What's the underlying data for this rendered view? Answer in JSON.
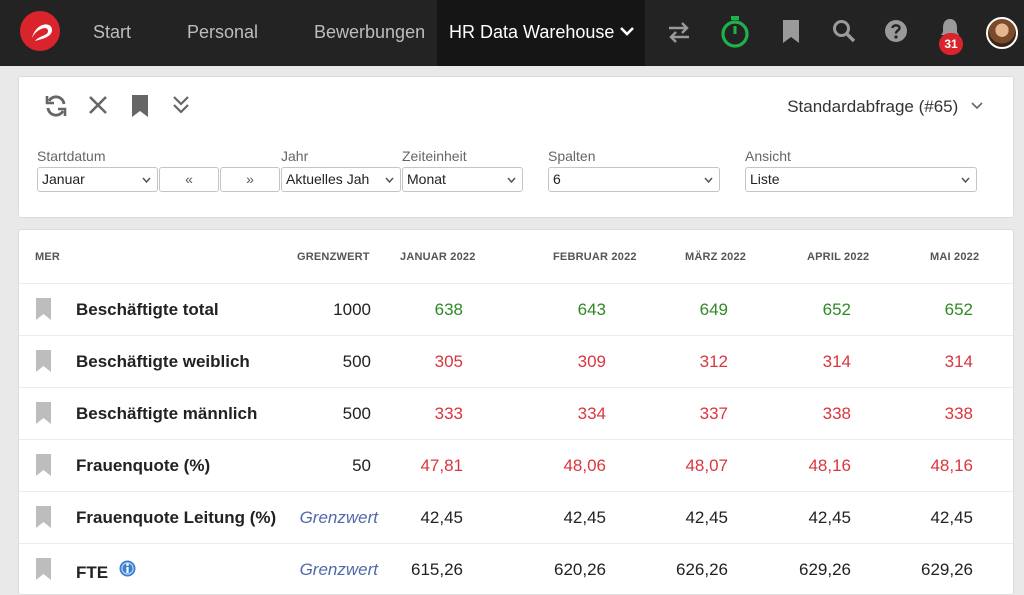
{
  "nav": {
    "items": [
      "Start",
      "Personal",
      "Bewerbungen"
    ],
    "active": "HR Data Warehouse",
    "notification_count": "31",
    "icons": [
      "swap-icon",
      "stopwatch-icon",
      "bookmark-icon",
      "search-icon",
      "help-icon",
      "bell-icon"
    ],
    "colors": {
      "brand": "#d9242b",
      "timer": "#21b14c"
    }
  },
  "toolbar": {
    "query": "Standardabfrage (#65)"
  },
  "filters": {
    "startdatum_label": "Startdatum",
    "startdatum_value": "Januar",
    "prev": "«",
    "next": "»",
    "jahr_label": "Jahr",
    "jahr_value": "Aktuelles Jah",
    "zeiteinheit_label": "Zeiteinheit",
    "zeiteinheit_value": "Monat",
    "spalten_label": "Spalten",
    "spalten_value": "6",
    "ansicht_label": "Ansicht",
    "ansicht_value": "Liste"
  },
  "table": {
    "headers": [
      "MER",
      "GRENZWERT",
      "JANUAR 2022",
      "FEBRUAR 2022",
      "MÄRZ 2022",
      "APRIL 2022",
      "MAI 2022"
    ],
    "rows": [
      {
        "label": "Beschäftigte total",
        "limit": "1000",
        "values": [
          "638",
          "643",
          "649",
          "652",
          "652"
        ],
        "color": "green"
      },
      {
        "label": "Beschäftigte weiblich",
        "limit": "500",
        "values": [
          "305",
          "309",
          "312",
          "314",
          "314"
        ],
        "color": "red"
      },
      {
        "label": "Beschäftigte männlich",
        "limit": "500",
        "values": [
          "333",
          "334",
          "337",
          "338",
          "338"
        ],
        "color": "red"
      },
      {
        "label": "Frauenquote (%)",
        "limit": "50",
        "values": [
          "47,81",
          "48,06",
          "48,07",
          "48,16",
          "48,16"
        ],
        "color": "red"
      },
      {
        "label": "Frauenquote Leitung (%)",
        "limit": "Grenzwert",
        "values": [
          "42,45",
          "42,45",
          "42,45",
          "42,45",
          "42,45"
        ],
        "color": "black"
      },
      {
        "label": "FTE",
        "limit": "Grenzwert",
        "values": [
          "615,26",
          "620,26",
          "626,26",
          "629,26",
          "629,26"
        ],
        "color": "black"
      }
    ]
  }
}
